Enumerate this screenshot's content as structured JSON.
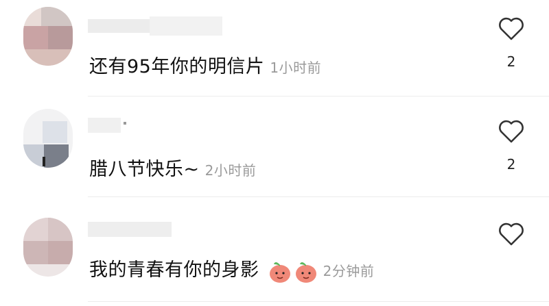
{
  "comments": [
    {
      "text": "还有95年你的明信片",
      "time": "1小时前",
      "likes": "2"
    },
    {
      "text": "腊八节快乐~",
      "time": "2小时前",
      "likes": "2"
    },
    {
      "text": "我的青春有你的身影",
      "time": "2分钟前",
      "emoji": "peach-face-emoji"
    }
  ],
  "icons": {
    "like": "heart-outline-icon"
  },
  "colors": {
    "text": "#111111",
    "timestamp": "#9a9a9a",
    "divider": "#ececec",
    "heart": "#333333",
    "emoji": "#f08878"
  }
}
